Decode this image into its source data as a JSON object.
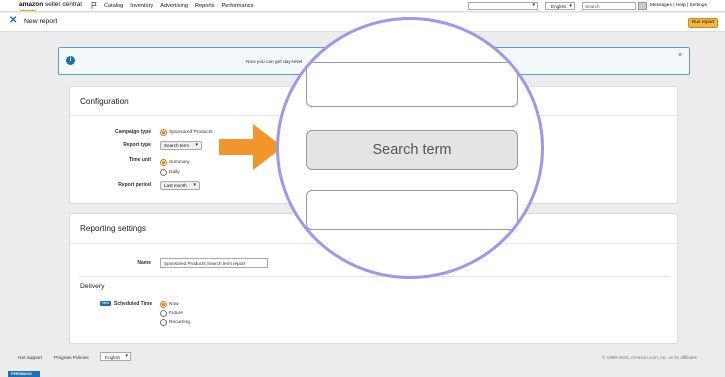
{
  "topnav": {
    "logo_main": "amazon",
    "logo_sub": "seller central",
    "items": [
      "Catalog",
      "Inventory",
      "Advertising",
      "Reports",
      "Performance"
    ],
    "language": "English",
    "search_placeholder": "Search",
    "links": "Messages | Help | Settings"
  },
  "header": {
    "title": "New report",
    "run_button": "Run report"
  },
  "banner": {
    "text": "Now you can get day-level"
  },
  "configuration": {
    "title": "Configuration",
    "campaign_type_label": "Campaign type",
    "campaign_type_value": "Sponsored Products",
    "report_type_label": "Report type",
    "report_type_value": "Search term",
    "time_unit_label": "Time unit",
    "time_unit_options": [
      "Summary",
      "Daily"
    ],
    "report_period_label": "Report period",
    "report_period_value": "Last month"
  },
  "reporting": {
    "title": "Reporting settings",
    "name_label": "Name",
    "name_value": "Sponsored Products Search term report",
    "delivery_title": "Delivery",
    "new_tag": "New",
    "scheduled_label": "Scheduled Time",
    "scheduled_options": [
      "Now",
      "Future",
      "Recurring"
    ]
  },
  "footer": {
    "get_support": "Get support",
    "program_policies": "Program Policies",
    "language": "English",
    "copyright": "© 1999-2020, Amazon.com, Inc. or its affiliates",
    "feedback": "FEEDBACK"
  },
  "magnifier": {
    "highlight": "Search term"
  },
  "colors": {
    "accent": "#e47911",
    "arrow": "#f0962a",
    "magnifier_ring": "#9b98ee",
    "link_blue": "#1a6fb5"
  }
}
